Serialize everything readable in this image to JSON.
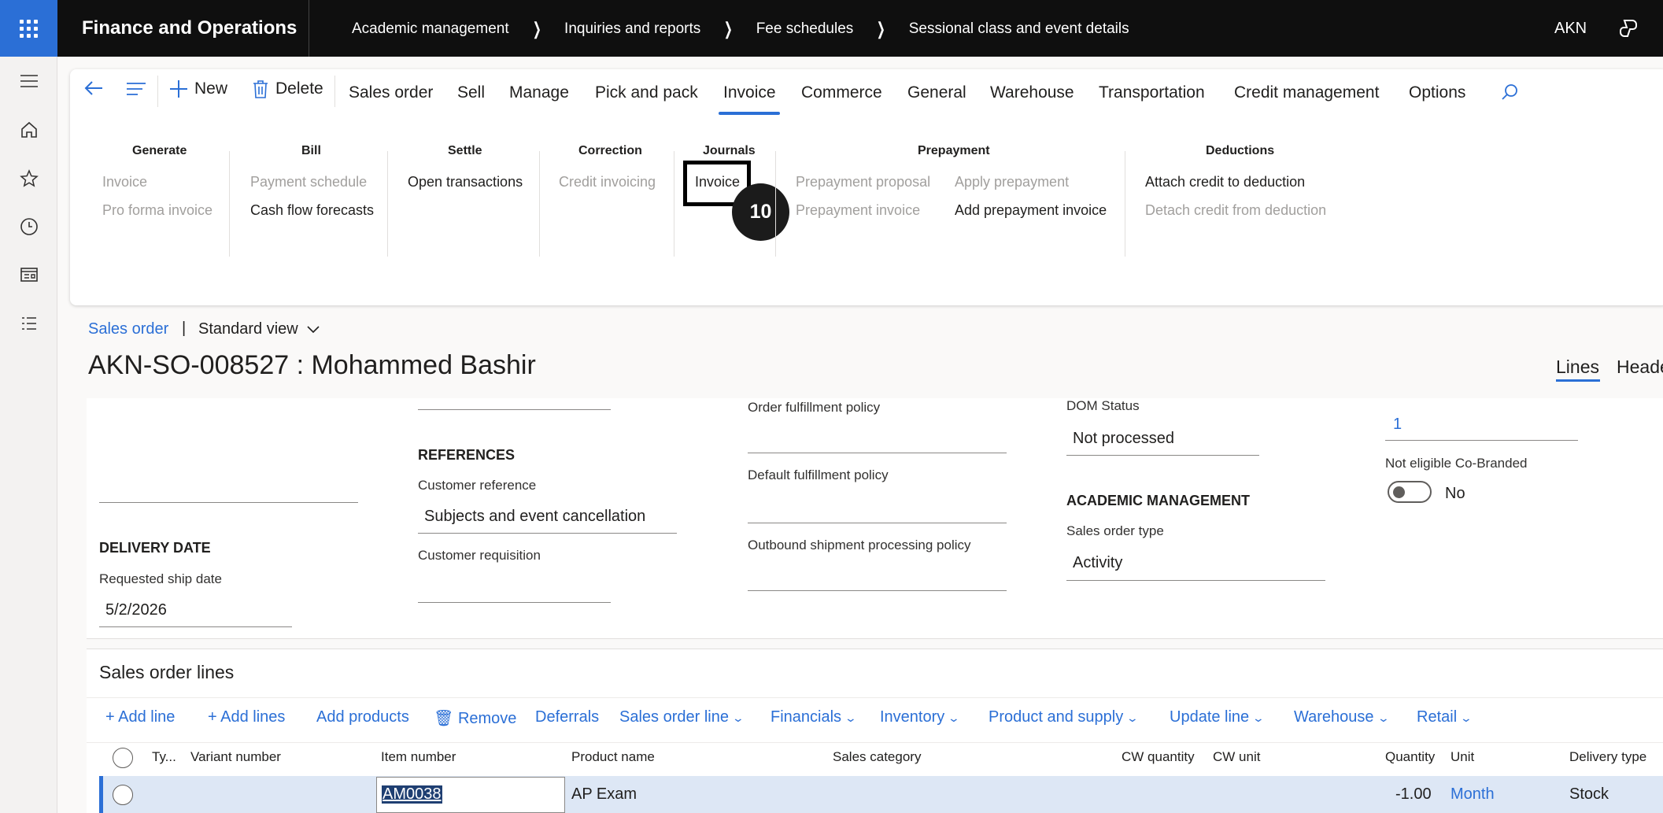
{
  "topbar": {
    "app_title": "Finance and Operations",
    "breadcrumb": [
      "Academic management",
      "Inquiries and reports",
      "Fee schedules",
      "Sessional class and event details"
    ],
    "user_initials": "AKN"
  },
  "actionpane": {
    "new_label": "New",
    "delete_label": "Delete",
    "tabs": [
      "Sales order",
      "Sell",
      "Manage",
      "Pick and pack",
      "Invoice",
      "Commerce",
      "General",
      "Warehouse",
      "Transportation",
      "Credit management",
      "Options"
    ],
    "active_tab": "Invoice",
    "groups": {
      "generate": {
        "title": "Generate",
        "items": [
          "Invoice",
          "Pro forma invoice"
        ]
      },
      "bill": {
        "title": "Bill",
        "items": [
          "Payment schedule",
          "Cash flow forecasts"
        ]
      },
      "settle": {
        "title": "Settle",
        "items": [
          "Open transactions"
        ]
      },
      "correction": {
        "title": "Correction",
        "items": [
          "Credit invoicing"
        ]
      },
      "journals": {
        "title": "Journals",
        "items": [
          "Invoice"
        ]
      },
      "prepayment": {
        "title": "Prepayment",
        "items": [
          "Prepayment proposal",
          "Prepayment invoice",
          "Apply prepayment",
          "Add prepayment invoice"
        ]
      },
      "deductions": {
        "title": "Deductions",
        "items": [
          "Attach credit to deduction",
          "Detach credit from deduction"
        ]
      }
    },
    "step_badge": "10"
  },
  "page": {
    "link": "Sales order",
    "separator": "|",
    "view": "Standard view",
    "title": "AKN-SO-008527 : Mohammed Bashir",
    "view_tabs": [
      "Lines",
      "Heade"
    ]
  },
  "form": {
    "delivery_date_section": "DELIVERY DATE",
    "requested_ship_date_label": "Requested ship date",
    "requested_ship_date": "5/2/2026",
    "references_section": "REFERENCES",
    "customer_reference_label": "Customer reference",
    "customer_reference": "Subjects and event cancellation",
    "customer_requisition_label": "Customer requisition",
    "order_fulfillment_policy_label": "Order fulfillment policy",
    "default_fulfillment_policy_label": "Default fulfillment policy",
    "outbound_policy_label": "Outbound shipment processing policy",
    "dom_status_label": "DOM Status",
    "dom_status": "Not processed",
    "academic_section": "ACADEMIC MANAGEMENT",
    "sales_order_type_label": "Sales order type",
    "sales_order_type": "Activity",
    "right_value": "1",
    "co_branded_label": "Not eligible Co-Branded",
    "co_branded_value": "No"
  },
  "lines": {
    "title": "Sales order lines",
    "toolbar": [
      "Add line",
      "Add lines",
      "Add products",
      "Remove",
      "Deferrals",
      "Sales order line",
      "Financials",
      "Inventory",
      "Product and supply",
      "Update line",
      "Warehouse",
      "Retail"
    ],
    "columns": [
      "Ty...",
      "Variant number",
      "Item number",
      "Product name",
      "Sales category",
      "CW quantity",
      "CW unit",
      "Quantity",
      "Unit",
      "Delivery type"
    ],
    "rows": [
      {
        "item_number": "AM0038",
        "product_name": "AP Exam",
        "quantity": "-1.00",
        "unit": "Month",
        "delivery_type": "Stock"
      }
    ]
  },
  "colors": {
    "accent": "#2b6fd6",
    "topbar": "#0f0f0f",
    "selected_row": "#dde7f5"
  }
}
